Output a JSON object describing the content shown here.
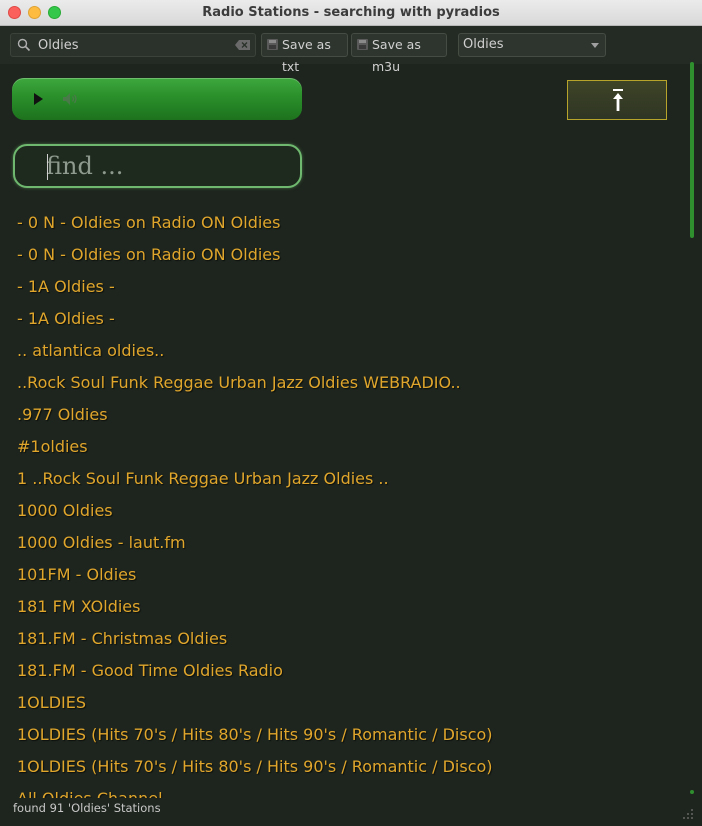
{
  "window": {
    "title": "Radio Stations - searching with pyradios"
  },
  "toolbar": {
    "search_value": "Oldies",
    "save_txt_label": "Save as txt",
    "save_m3u_label": "Save as m3u",
    "genre_selected": "Oldies"
  },
  "player": {
    "play_icon": "play-icon",
    "volume_icon": "volume-icon"
  },
  "find": {
    "placeholder": "find ..."
  },
  "stations": [
    "- 0 N - Oldies on Radio ON Oldies",
    "- 0 N - Oldies on Radio ON Oldies",
    "- 1A Oldies -",
    "- 1A Oldies -",
    ".. atlantica oldies..",
    "..Rock Soul Funk Reggae Urban Jazz Oldies WEBRADIO..",
    ".977 Oldies",
    "#1oldies",
    "1 ..Rock Soul Funk Reggae Urban Jazz Oldies ..",
    "1000 Oldies",
    "1000 Oldies - laut.fm",
    "101FM - Oldies",
    "181 FM XOldies",
    "181.FM - Christmas Oldies",
    "181.FM - Good Time Oldies Radio",
    "1OLDIES",
    "1OLDIES (Hits 70's / Hits 80's / Hits 90's / Romantic / Disco)",
    "1OLDIES (Hits 70's / Hits 80's / Hits 90's / Romantic / Disco)",
    "All Oldies Channel"
  ],
  "status": {
    "text": "found 91 'Oldies' Stations"
  },
  "colors": {
    "background": "#1e251e",
    "station_text": "#e0a62c",
    "player_green": "#2a8f2a",
    "accent_border": "#b6a52a"
  }
}
